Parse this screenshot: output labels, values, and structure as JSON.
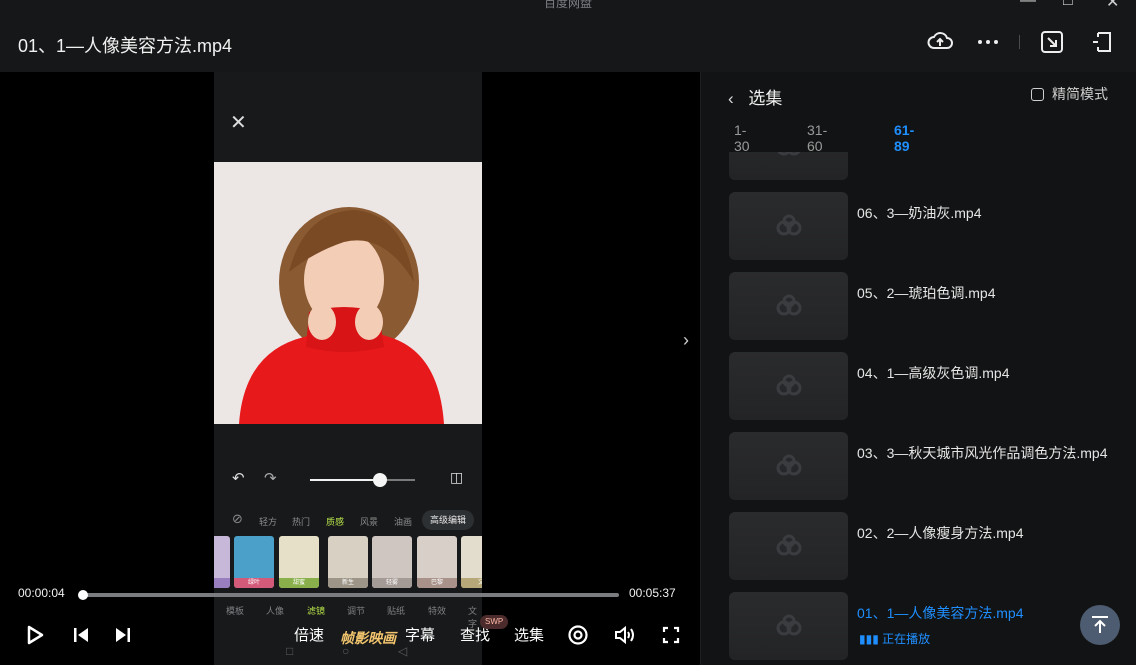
{
  "app": {
    "name": "百度网盘"
  },
  "header": {
    "title": "01、1—人像美容方法.mp4"
  },
  "player": {
    "current_time": "00:00:04",
    "duration": "00:05:37",
    "progress_fraction": 0.012,
    "controls": {
      "speed": "倍速",
      "brand": "帧影映画",
      "subtitle": "字幕",
      "search": "查找",
      "search_badge": "SWP",
      "episodes": "选集"
    }
  },
  "phone_ui": {
    "filter_tabs": [
      "轻方",
      "热门",
      "质感",
      "风景",
      "油画"
    ],
    "advanced": "高级编辑",
    "thumbs": [
      "",
      "绿叶",
      "甜蜜",
      "新生",
      "轻雾",
      "巴黎",
      "文"
    ],
    "bottom_tabs": [
      "模板",
      "人像",
      "滤镜",
      "调节",
      "贴纸",
      "特效",
      "文字"
    ]
  },
  "panel": {
    "title": "选集",
    "simple_mode": "精简模式",
    "ranges": [
      "1-30",
      "31-60",
      "61-89"
    ],
    "active_range": "61-89",
    "episodes": [
      {
        "title": ""
      },
      {
        "title": "06、3—奶油灰.mp4"
      },
      {
        "title": "05、2—琥珀色调.mp4"
      },
      {
        "title": "04、1—高级灰色调.mp4"
      },
      {
        "title": "03、3—秋天城市风光作品调色方法.mp4"
      },
      {
        "title": "02、2—人像瘦身方法.mp4"
      },
      {
        "title": "01、1—人像美容方法.mp4",
        "status": "正在播放"
      }
    ]
  },
  "colors": {
    "accent": "#1f8fff",
    "background": "#121314"
  }
}
